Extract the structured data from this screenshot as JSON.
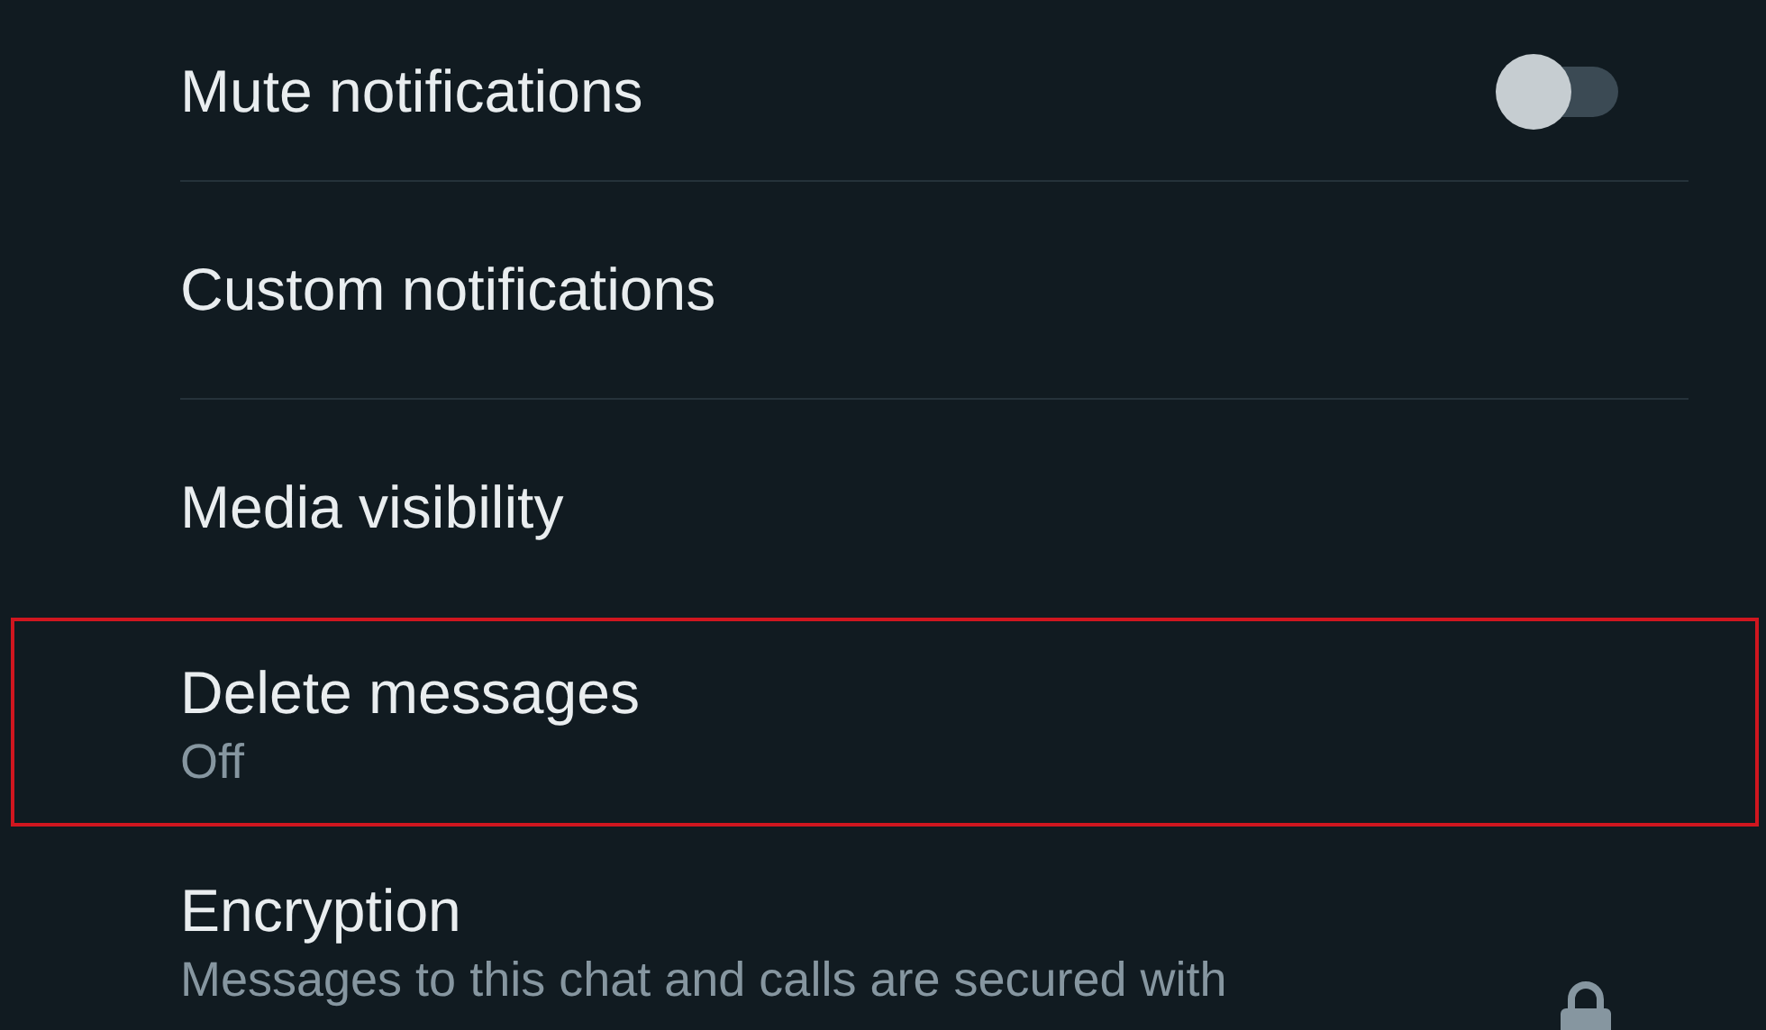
{
  "settings": [
    {
      "kind": "toggle",
      "title": "Mute notifications",
      "on": false,
      "highlighted": false
    },
    {
      "kind": "plain",
      "title": "Custom notifications",
      "highlighted": false
    },
    {
      "kind": "plain",
      "title": "Media visibility",
      "highlighted": false
    },
    {
      "kind": "subtitle",
      "title": "Delete messages",
      "subtitle": "Off",
      "highlighted": true
    },
    {
      "kind": "lock",
      "title": "Encryption",
      "subtitle": "Messages to this chat and calls are secured with",
      "highlighted": false
    }
  ]
}
